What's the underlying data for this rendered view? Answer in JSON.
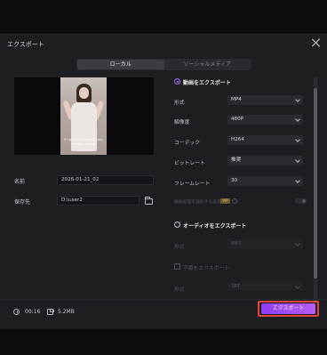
{
  "dialog": {
    "title": "エクスポート",
    "tabs": [
      {
        "label": "ローカル",
        "active": true
      },
      {
        "label": "ソーシャルメディア",
        "active": false
      }
    ]
  },
  "preview": {
    "caption": "if I promise you, for you, my love for you"
  },
  "left_form": {
    "name_label": "名前",
    "name_value": "2026-01-21_02",
    "save_label": "保存先",
    "save_value": "D:\\user2"
  },
  "video_section": {
    "label": "動画をエクスポート",
    "selected": true,
    "rows": [
      {
        "label": "形式",
        "value": "MP4"
      },
      {
        "label": "解像度",
        "value": "480P"
      },
      {
        "label": "コーデック",
        "value": "H264"
      },
      {
        "label": "ビットレート",
        "value": "推奨"
      },
      {
        "label": "フレームレート",
        "value": "30"
      }
    ],
    "hw_label": "動画処理を強化する設定",
    "vip_badge": "VIP"
  },
  "audio_section": {
    "label": "オーディオをエクスポート",
    "format_label": "形式",
    "format_value": "MP3"
  },
  "subtitle_section": {
    "label": "字幕をエクスポート",
    "format_label": "形式",
    "format_value": "SRT"
  },
  "footer": {
    "duration": "00:16",
    "size": "5.2MB",
    "export_label": "エクスポート"
  },
  "colors": {
    "accent": "#a16cff",
    "button_start": "#8e3df2",
    "button_end": "#b65cf6",
    "highlight": "#e0453a"
  }
}
